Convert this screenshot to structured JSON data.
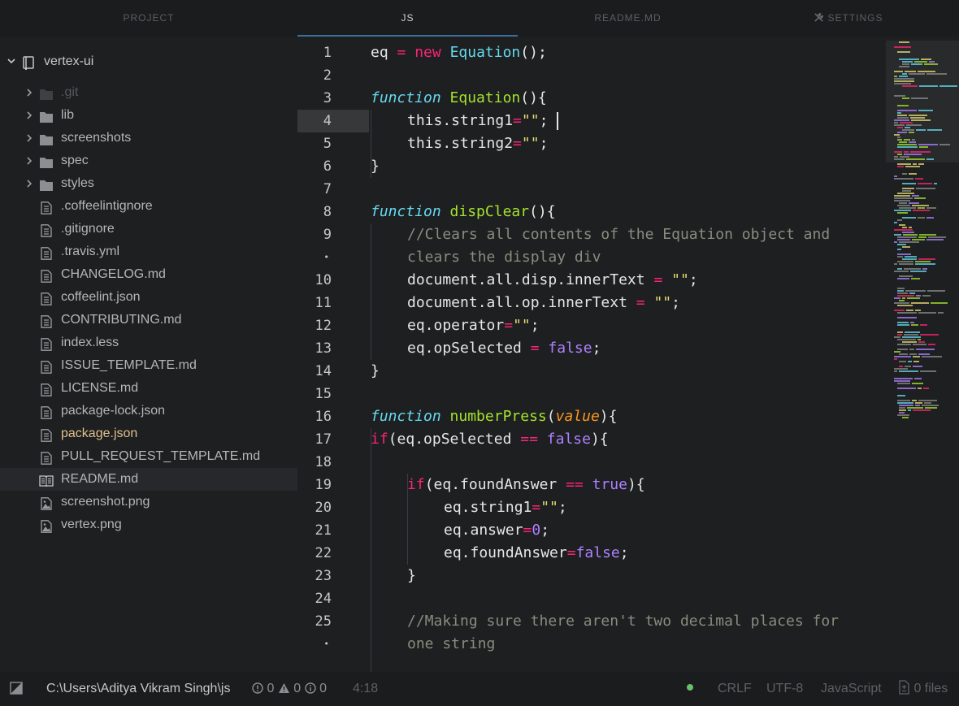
{
  "tabs": {
    "project": "PROJECT",
    "js": "JS",
    "readme": "README.MD",
    "settings": "SETTINGS"
  },
  "tree": {
    "root": "vertex-ui",
    "items": [
      {
        "label": ".git",
        "type": "folder",
        "state": "ignored"
      },
      {
        "label": "lib",
        "type": "folder"
      },
      {
        "label": "screenshots",
        "type": "folder"
      },
      {
        "label": "spec",
        "type": "folder"
      },
      {
        "label": "styles",
        "type": "folder"
      },
      {
        "label": ".coffeelintignore",
        "type": "file"
      },
      {
        "label": ".gitignore",
        "type": "file"
      },
      {
        "label": ".travis.yml",
        "type": "file"
      },
      {
        "label": "CHANGELOG.md",
        "type": "file"
      },
      {
        "label": "coffeelint.json",
        "type": "file"
      },
      {
        "label": "CONTRIBUTING.md",
        "type": "file"
      },
      {
        "label": "index.less",
        "type": "file"
      },
      {
        "label": "ISSUE_TEMPLATE.md",
        "type": "file"
      },
      {
        "label": "LICENSE.md",
        "type": "file"
      },
      {
        "label": "package-lock.json",
        "type": "file"
      },
      {
        "label": "package.json",
        "type": "file",
        "state": "modified"
      },
      {
        "label": "PULL_REQUEST_TEMPLATE.md",
        "type": "file"
      },
      {
        "label": "README.md",
        "type": "book",
        "state": "selected"
      },
      {
        "label": "screenshot.png",
        "type": "image"
      },
      {
        "label": "vertex.png",
        "type": "image"
      }
    ]
  },
  "editor": {
    "cursor_line": 4,
    "lines": [
      {
        "n": "1",
        "indent": 0,
        "tokens": [
          [
            "",
            "eq "
          ],
          [
            "op",
            "="
          ],
          [
            "",
            " "
          ],
          [
            "kw",
            "new"
          ],
          [
            "",
            " "
          ],
          [
            "cls",
            "Equation"
          ],
          [
            "",
            "();"
          ]
        ]
      },
      {
        "n": "2",
        "indent": 0,
        "tokens": []
      },
      {
        "n": "3",
        "indent": 0,
        "tokens": [
          [
            "kw-fn",
            "function"
          ],
          [
            "",
            " "
          ],
          [
            "name",
            "Equation"
          ],
          [
            "",
            "(){"
          ]
        ]
      },
      {
        "n": "4",
        "indent": 1,
        "tokens": [
          [
            "",
            "this.string1"
          ],
          [
            "op",
            "="
          ],
          [
            "str",
            "\"\""
          ],
          [
            "",
            ";"
          ]
        ]
      },
      {
        "n": "5",
        "indent": 1,
        "tokens": [
          [
            "",
            "this.string2"
          ],
          [
            "op",
            "="
          ],
          [
            "str",
            "\"\""
          ],
          [
            "",
            ";"
          ]
        ]
      },
      {
        "n": "6",
        "indent": 0,
        "tokens": [
          [
            "",
            "}"
          ]
        ]
      },
      {
        "n": "7",
        "indent": 0,
        "tokens": []
      },
      {
        "n": "8",
        "indent": 0,
        "tokens": [
          [
            "kw-fn",
            "function"
          ],
          [
            "",
            " "
          ],
          [
            "name",
            "dispClear"
          ],
          [
            "",
            "(){"
          ]
        ]
      },
      {
        "n": "9",
        "indent": 1,
        "tokens": [
          [
            "cmt",
            "//Clears all contents of the Equation object and"
          ]
        ]
      },
      {
        "n": "•",
        "indent": 1,
        "tokens": [
          [
            "cmt",
            "clears the display div"
          ]
        ]
      },
      {
        "n": "10",
        "indent": 1,
        "tokens": [
          [
            "",
            "document.all.disp.innerText "
          ],
          [
            "op",
            "="
          ],
          [
            "",
            " "
          ],
          [
            "str",
            "\"\""
          ],
          [
            "",
            ";"
          ]
        ]
      },
      {
        "n": "11",
        "indent": 1,
        "tokens": [
          [
            "",
            "document.all.op.innerText "
          ],
          [
            "op",
            "="
          ],
          [
            "",
            " "
          ],
          [
            "str",
            "\"\""
          ],
          [
            "",
            ";"
          ]
        ]
      },
      {
        "n": "12",
        "indent": 1,
        "tokens": [
          [
            "",
            "eq.operator"
          ],
          [
            "op",
            "="
          ],
          [
            "str",
            "\"\""
          ],
          [
            "",
            ";"
          ]
        ]
      },
      {
        "n": "13",
        "indent": 1,
        "tokens": [
          [
            "",
            "eq.opSelected "
          ],
          [
            "op",
            "="
          ],
          [
            "",
            " "
          ],
          [
            "bool",
            "false"
          ],
          [
            "",
            ";"
          ]
        ]
      },
      {
        "n": "14",
        "indent": 0,
        "tokens": [
          [
            "",
            "}"
          ]
        ]
      },
      {
        "n": "15",
        "indent": 0,
        "tokens": []
      },
      {
        "n": "16",
        "indent": 0,
        "tokens": [
          [
            "kw-fn",
            "function"
          ],
          [
            "",
            " "
          ],
          [
            "name",
            "numberPress"
          ],
          [
            "",
            "("
          ],
          [
            "param",
            "value"
          ],
          [
            "",
            "){"
          ]
        ]
      },
      {
        "n": "17",
        "indent": 0,
        "tokens": [
          [
            "kw",
            "if"
          ],
          [
            "",
            "(eq.opSelected "
          ],
          [
            "op",
            "=="
          ],
          [
            "",
            " "
          ],
          [
            "bool",
            "false"
          ],
          [
            "",
            "){"
          ]
        ]
      },
      {
        "n": "18",
        "indent": 0,
        "tokens": []
      },
      {
        "n": "19",
        "indent": 1,
        "tokens": [
          [
            "kw",
            "if"
          ],
          [
            "",
            "(eq.foundAnswer "
          ],
          [
            "op",
            "=="
          ],
          [
            "",
            " "
          ],
          [
            "bool",
            "true"
          ],
          [
            "",
            "){"
          ]
        ]
      },
      {
        "n": "20",
        "indent": 2,
        "tokens": [
          [
            "",
            "eq.string1"
          ],
          [
            "op",
            "="
          ],
          [
            "str",
            "\"\""
          ],
          [
            "",
            ";"
          ]
        ]
      },
      {
        "n": "21",
        "indent": 2,
        "tokens": [
          [
            "",
            "eq.answer"
          ],
          [
            "op",
            "="
          ],
          [
            "num",
            "0"
          ],
          [
            "",
            ";"
          ]
        ]
      },
      {
        "n": "22",
        "indent": 2,
        "tokens": [
          [
            "",
            "eq.foundAnswer"
          ],
          [
            "op",
            "="
          ],
          [
            "bool",
            "false"
          ],
          [
            "",
            ";"
          ]
        ]
      },
      {
        "n": "23",
        "indent": 1,
        "tokens": [
          [
            "",
            "}"
          ]
        ]
      },
      {
        "n": "24",
        "indent": 0,
        "tokens": []
      },
      {
        "n": "25",
        "indent": 1,
        "tokens": [
          [
            "cmt",
            "//Making sure there aren't two decimal places for"
          ]
        ]
      },
      {
        "n": "•",
        "indent": 1,
        "tokens": [
          [
            "cmt",
            "one string"
          ]
        ]
      }
    ]
  },
  "status": {
    "path": "C:\\Users\\Aditya Vikram Singh\\js",
    "errors": "0",
    "warnings": "0",
    "infos": "0",
    "cursor": "4:18",
    "line_ending": "CRLF",
    "encoding": "UTF-8",
    "grammar": "JavaScript",
    "files": "0 files"
  }
}
